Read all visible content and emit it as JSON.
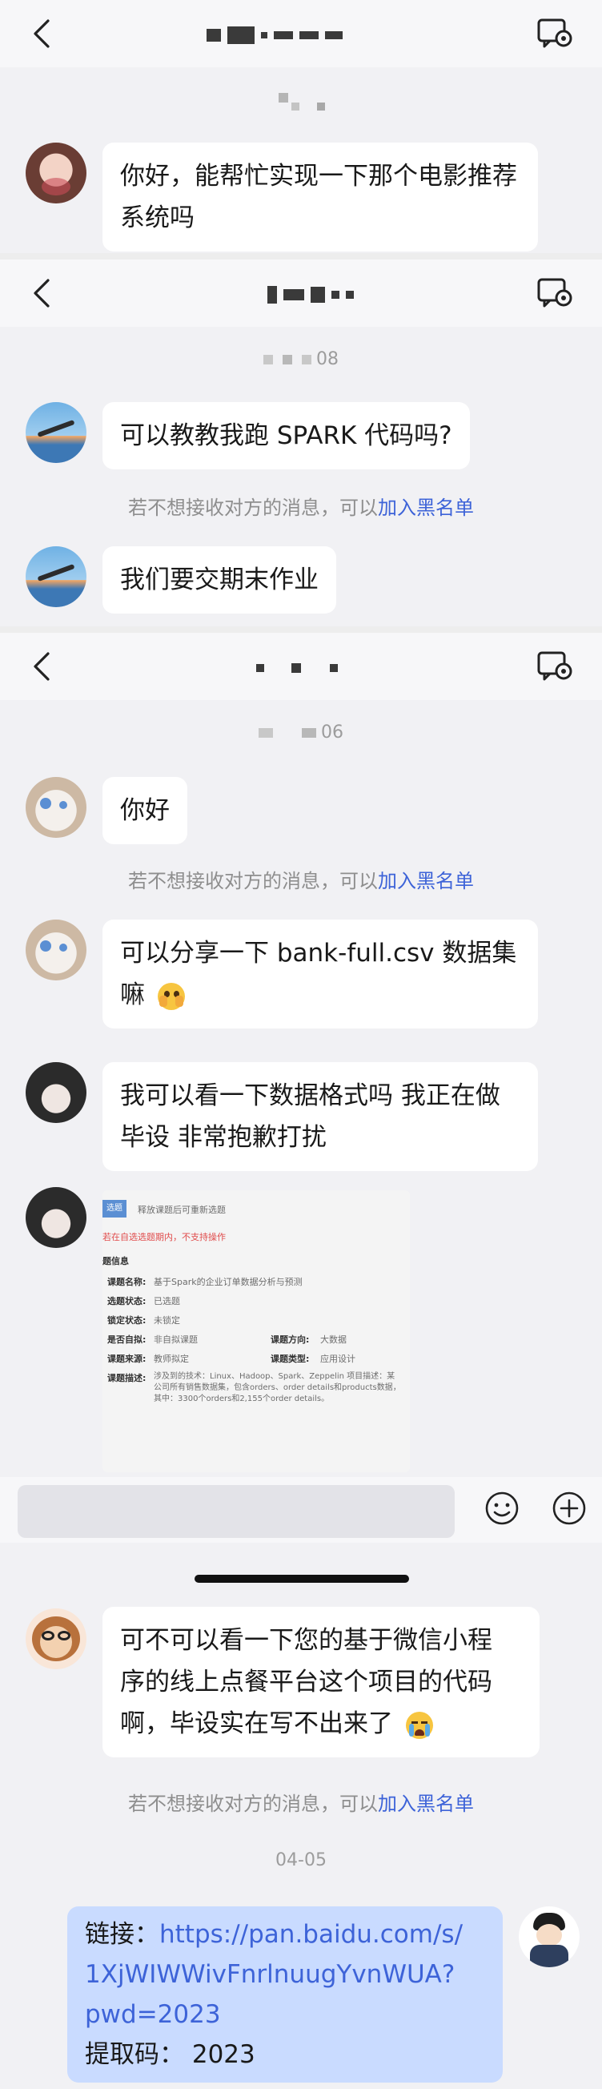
{
  "screen1": {
    "msg1": "你好，能帮忙实现一下那个电影推荐系统吗"
  },
  "screen2": {
    "timestamp": "08",
    "msg1": "可以教教我跑 SPARK 代码吗?",
    "sysnote_prefix": "若不想接收对方的消息，可以",
    "sysnote_link": "加入黑名单",
    "msg2": "我们要交期末作业"
  },
  "screen3": {
    "timestamp": "06",
    "msg1": "你好",
    "sysnote_prefix": "若不想接收对方的消息，可以",
    "sysnote_link": "加入黑名单",
    "msg2_line1": "可以分享一下 bank-full.csv 数据集",
    "msg2_line2": "嘛",
    "msg3_line1": "我可以看一下数据格式吗 我正在做",
    "msg3_line2": "毕设 非常抱歉打扰",
    "attachment": {
      "header_tag": "选题",
      "header_text": "释放课题后可重新选题",
      "warning": "若在自选选题期内，不支持操作",
      "section": "题信息",
      "rows": [
        {
          "label": "课题名称:",
          "value": "基于Spark的企业订单数据分析与预测"
        },
        {
          "label": "选题状态:",
          "value": "已选题"
        },
        {
          "label": "锁定状态:",
          "value": "未锁定"
        },
        {
          "label": "是否自拟:",
          "value": "非自拟课题",
          "label2": "课题方向:",
          "value2": "大数据"
        },
        {
          "label": "课题来源:",
          "value": "教师拟定",
          "label2": "课题类型:",
          "value2": "应用设计"
        },
        {
          "label": "课题描述:",
          "value": "涉及到的技术：Linux、Hadoop、Spark、Zeppelin 项目描述：某公司所有销售数据集，包含orders、order details和products数据，其中：3300个orders和2,155个order details。"
        }
      ]
    }
  },
  "screen4": {
    "msg1_line1": "可不可以看一下您的基于微信小程",
    "msg1_line2": "序的线上点餐平台这个项目的代码",
    "msg1_line3": "啊，毕设实在写不出来了",
    "sysnote_prefix": "若不想接收对方的消息，可以",
    "sysnote_link": "加入黑名单",
    "timestamp": "04-05",
    "reply_label": "链接：",
    "reply_link_line1": "https://pan.baidu.com/s/",
    "reply_link_line2": "1XjWIWWivFnrlnuugYvnWUA?",
    "reply_link_line3": "pwd=2023",
    "reply_code": "提取码：  2023"
  },
  "icons": {
    "back": "chevron-left-icon",
    "settings": "chat-settings-icon",
    "emoji": "smiley-icon",
    "plus": "plus-circle-icon"
  },
  "colors": {
    "link": "#3d63d8",
    "bubble_in": "#ffffff",
    "bubble_out": "#c9dbff",
    "background": "#f1f1f4"
  }
}
